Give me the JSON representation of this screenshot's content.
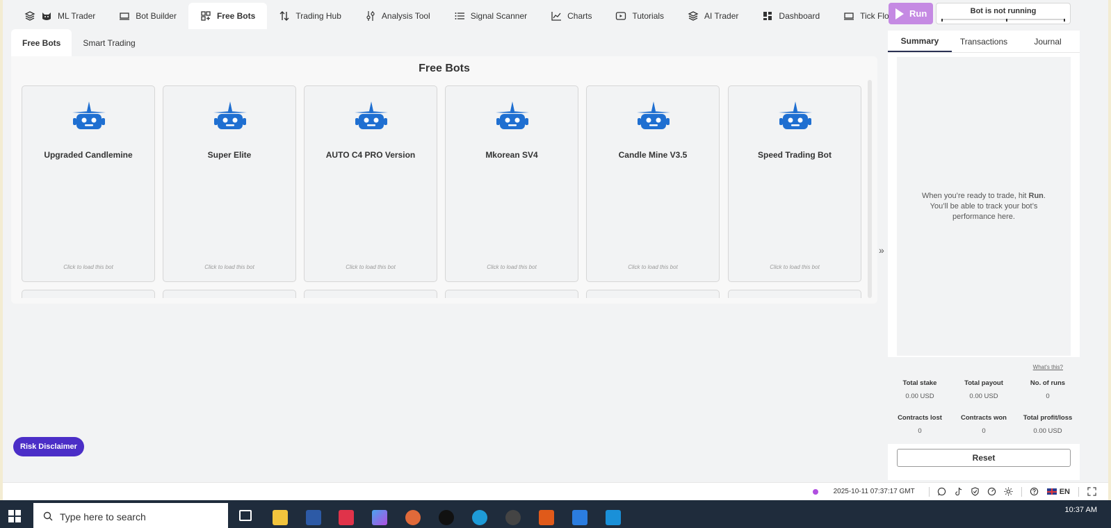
{
  "nav": [
    {
      "label": "ML Trader",
      "icon": "layers-icon"
    },
    {
      "label": "Bot Builder",
      "icon": "bot-builder-icon"
    },
    {
      "label": "Free Bots",
      "icon": "grid-icon",
      "active": true
    },
    {
      "label": "Trading Hub",
      "icon": "arrows-updown-icon"
    },
    {
      "label": "Analysis Tool",
      "icon": "sliders-icon"
    },
    {
      "label": "Signal Scanner",
      "icon": "list-icon"
    },
    {
      "label": "Charts",
      "icon": "chart-line-icon"
    },
    {
      "label": "Tutorials",
      "icon": "play-icon"
    },
    {
      "label": "AI Trader",
      "icon": "layers-icon"
    },
    {
      "label": "Dashboard",
      "icon": "dashboard-icon"
    },
    {
      "label": "Tick Flow Demo",
      "icon": "monitor-icon"
    }
  ],
  "subtabs": [
    {
      "label": "Free Bots",
      "active": true
    },
    {
      "label": "Smart Trading",
      "active": false
    }
  ],
  "main": {
    "title": "Free Bots",
    "card_hint": "Click to load this bot",
    "bots": [
      "Upgraded Candlemine",
      "Super Elite",
      "AUTO C4 PRO Version",
      "Mkorean SV4",
      "Candle Mine V3.5",
      "Speed Trading Bot"
    ],
    "robot_color": "#1f6fd1"
  },
  "run": {
    "label": "Run",
    "color": "#c58ae3"
  },
  "status": {
    "text": "Bot is not running"
  },
  "right": {
    "tabs": [
      "Summary",
      "Transactions",
      "Journal"
    ],
    "empty_text_pre": "When you’re ready to trade, hit ",
    "empty_text_bold": "Run",
    "empty_text_post": ". You’ll be able to track your bot’s performance here.",
    "whats_this": "What's this?",
    "stats": [
      {
        "label": "Total stake",
        "value": "0.00 USD"
      },
      {
        "label": "Total payout",
        "value": "0.00 USD"
      },
      {
        "label": "No. of runs",
        "value": "0"
      },
      {
        "label": "Contracts lost",
        "value": "0"
      },
      {
        "label": "Contracts won",
        "value": "0"
      },
      {
        "label": "Total profit/loss",
        "value": "0.00 USD"
      }
    ],
    "reset": "Reset"
  },
  "risk": {
    "label": "Risk Disclaimer",
    "color": "#4b2ec7"
  },
  "footer": {
    "time": "2025-10-11 07:37:17 GMT",
    "lang": "EN",
    "status_dot_color": "#b04fe0"
  },
  "taskbar": {
    "search_placeholder": "Type here to search",
    "clock": "10:37 AM"
  }
}
